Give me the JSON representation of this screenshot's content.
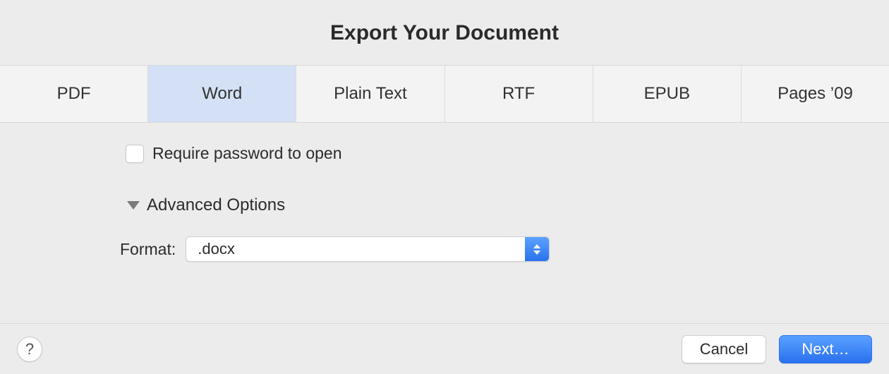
{
  "title": "Export Your Document",
  "tabs": [
    {
      "label": "PDF",
      "selected": false
    },
    {
      "label": "Word",
      "selected": true
    },
    {
      "label": "Plain Text",
      "selected": false
    },
    {
      "label": "RTF",
      "selected": false
    },
    {
      "label": "EPUB",
      "selected": false
    },
    {
      "label": "Pages ’09",
      "selected": false
    }
  ],
  "options": {
    "require_password_label": "Require password to open",
    "require_password_checked": false,
    "advanced_label": "Advanced Options",
    "advanced_expanded": true,
    "format_label": "Format:",
    "format_value": ".docx"
  },
  "footer": {
    "help_glyph": "?",
    "cancel_label": "Cancel",
    "next_label": "Next…"
  }
}
